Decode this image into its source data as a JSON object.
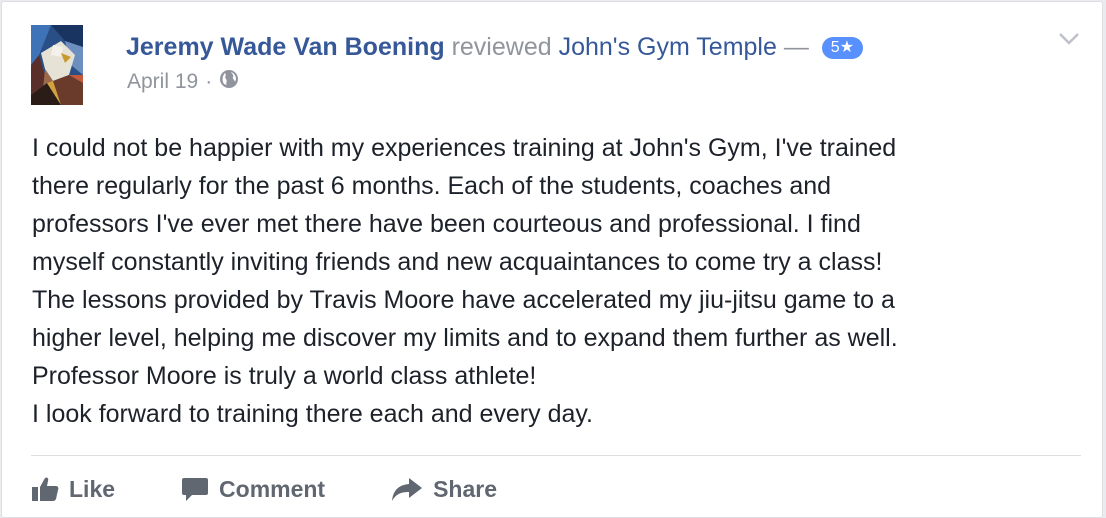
{
  "post": {
    "author": "Jeremy Wade Van Boening",
    "verb": "reviewed",
    "page_name": "John's Gym Temple",
    "dash": "—",
    "rating": "5★",
    "date": "April 19",
    "date_sep": "·",
    "privacy_icon": "globe-icon",
    "menu_icon": "chevron-down-icon",
    "body": [
      "I could not be happier with my experiences training at John's Gym, I've trained",
      "there regularly for the past 6 months. Each of the students, coaches and",
      "professors I've ever met there have been courteous and professional. I find",
      "myself constantly inviting friends and new acquaintances to come try a class!",
      "The lessons provided by Travis Moore have accelerated my jiu-jitsu game to a",
      "higher level, helping me discover my limits and to expand them further as well.",
      "Professor Moore is truly a world class athlete!",
      "I look forward to training there each and every day."
    ]
  },
  "actions": {
    "like": "Like",
    "comment": "Comment",
    "share": "Share"
  },
  "colors": {
    "link": "#365899",
    "muted": "#90949c",
    "text": "#1d2129",
    "action": "#616770",
    "rating_badge": "#5890ff"
  }
}
